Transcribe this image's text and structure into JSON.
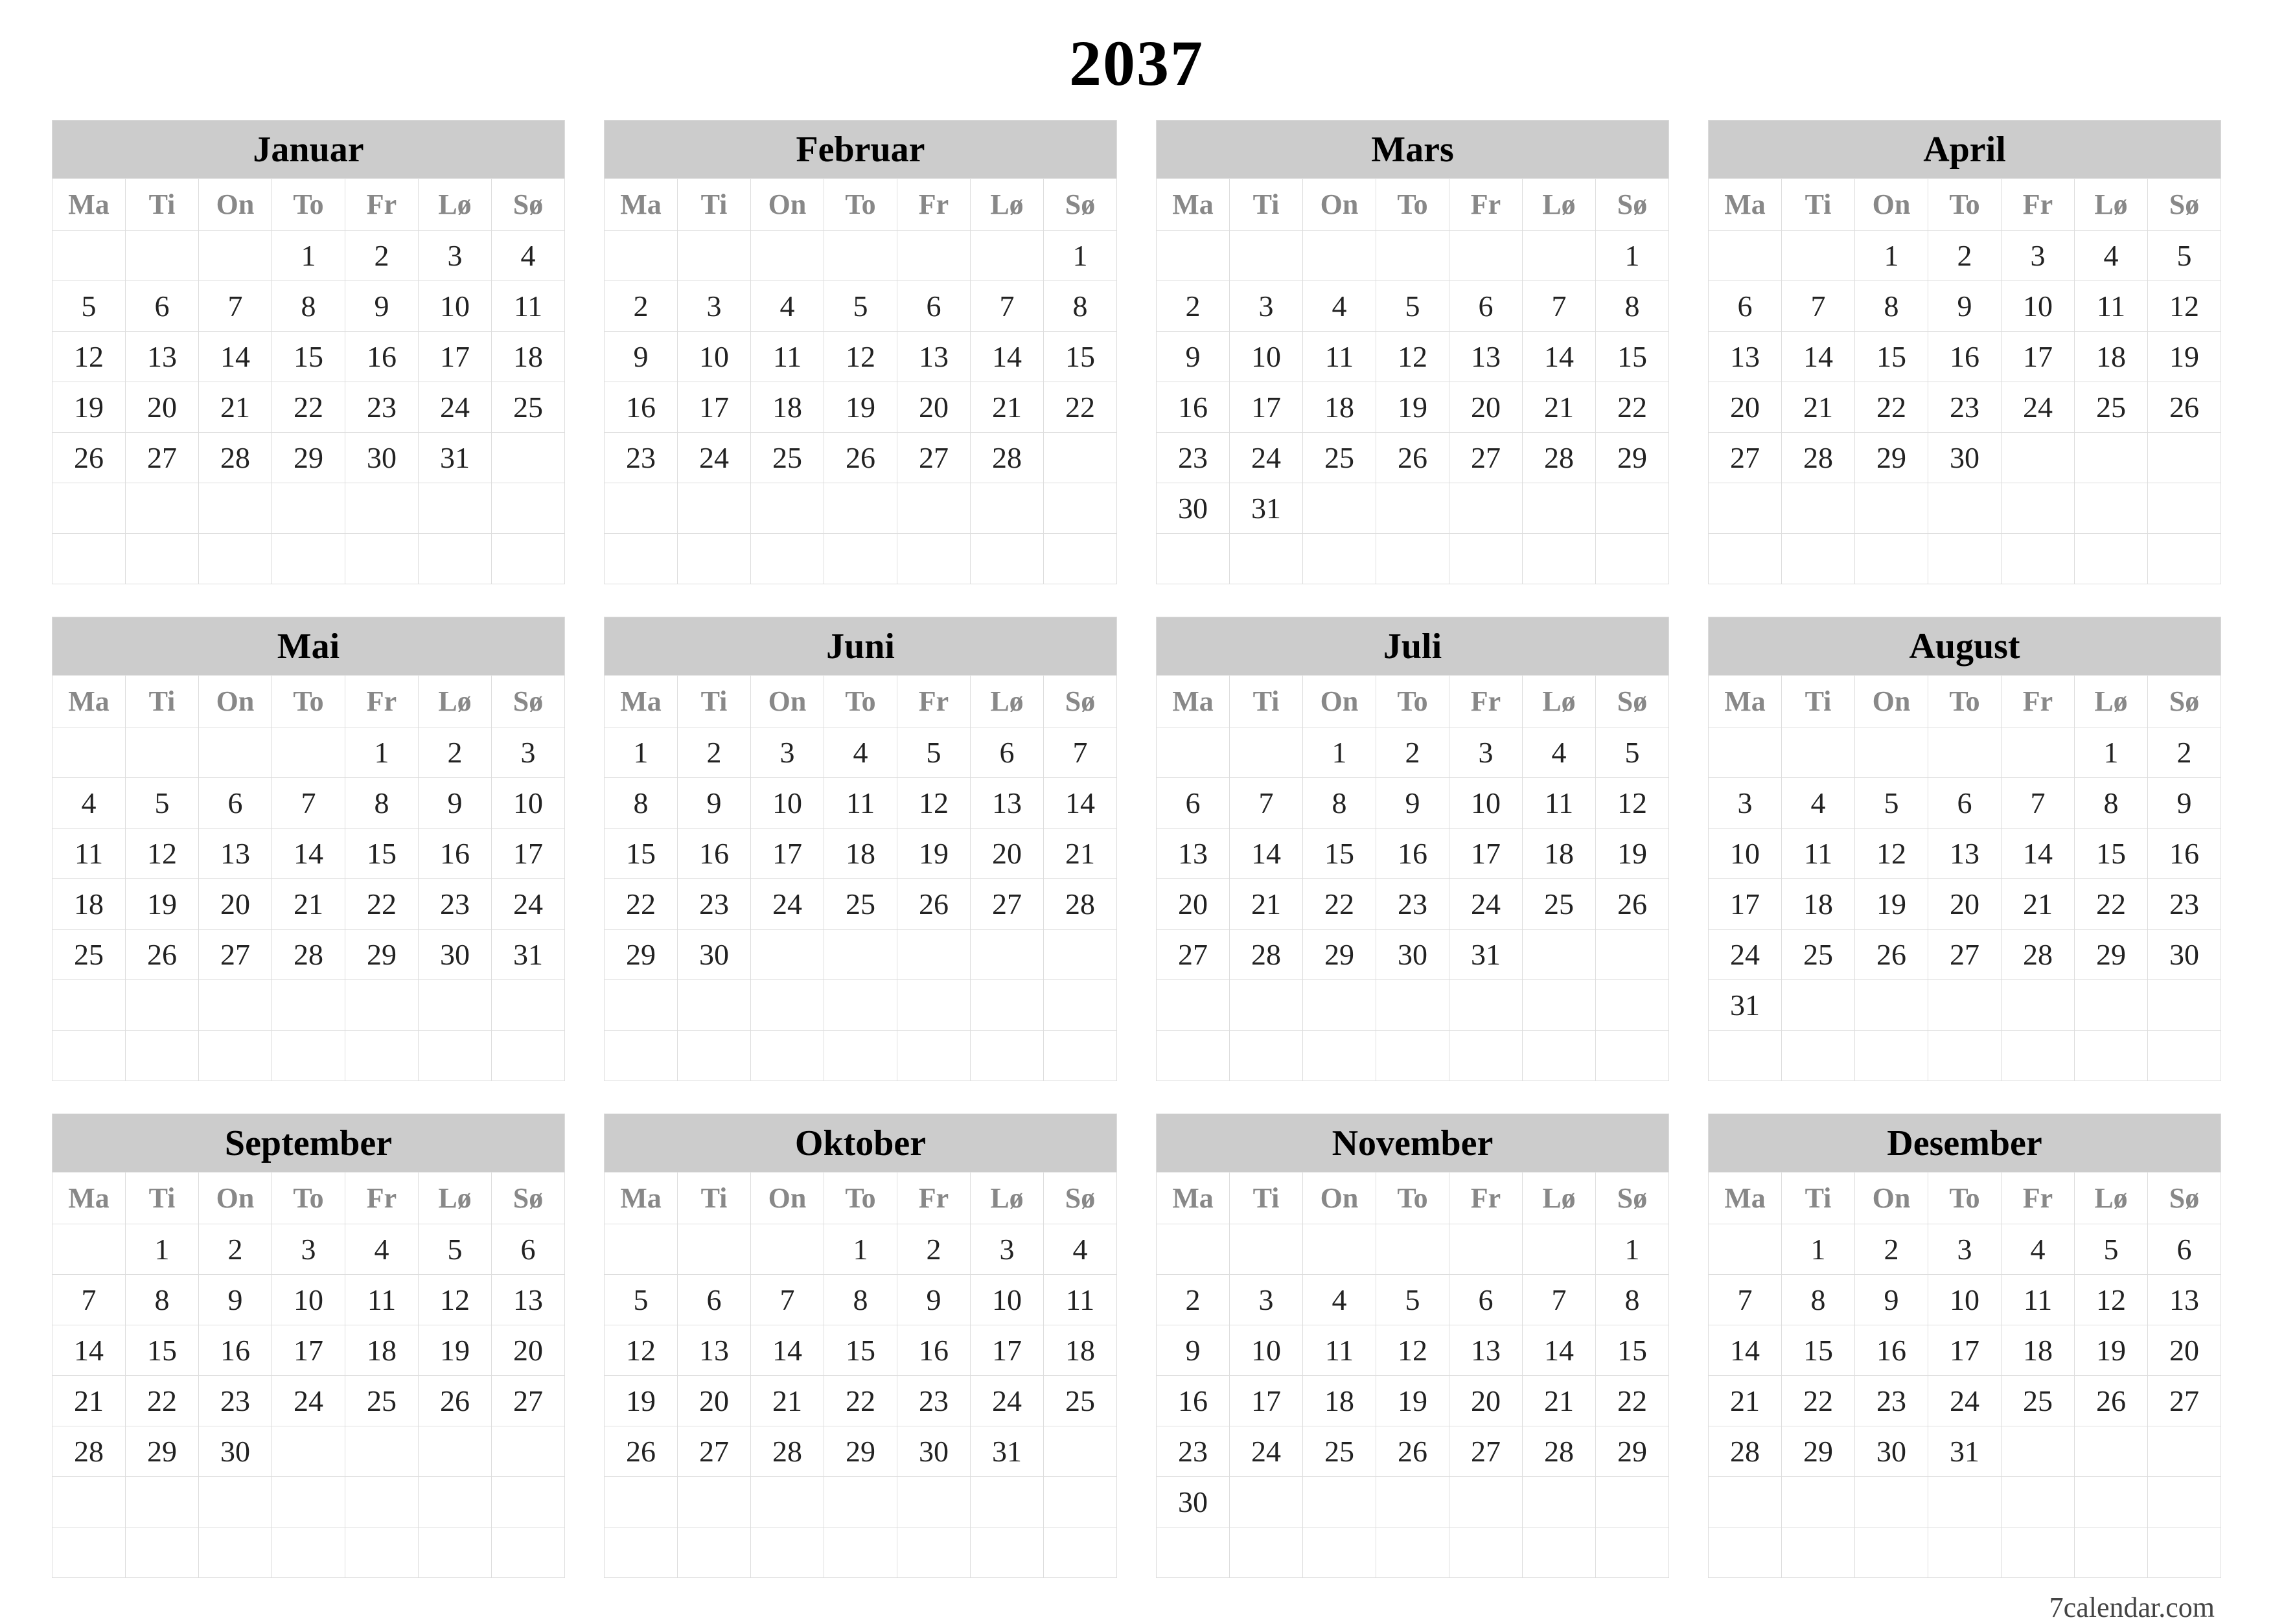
{
  "year": "2037",
  "footer": "7calendar.com",
  "weekdays": [
    "Ma",
    "Ti",
    "On",
    "To",
    "Fr",
    "Lø",
    "Sø"
  ],
  "months": [
    {
      "name": "Januar",
      "start": 4,
      "days": 31
    },
    {
      "name": "Februar",
      "start": 7,
      "days": 28
    },
    {
      "name": "Mars",
      "start": 7,
      "days": 31
    },
    {
      "name": "April",
      "start": 3,
      "days": 30
    },
    {
      "name": "Mai",
      "start": 5,
      "days": 31
    },
    {
      "name": "Juni",
      "start": 1,
      "days": 30
    },
    {
      "name": "Juli",
      "start": 3,
      "days": 31
    },
    {
      "name": "August",
      "start": 6,
      "days": 31
    },
    {
      "name": "September",
      "start": 2,
      "days": 30
    },
    {
      "name": "Oktober",
      "start": 4,
      "days": 31
    },
    {
      "name": "November",
      "start": 7,
      "days": 30
    },
    {
      "name": "Desember",
      "start": 2,
      "days": 31
    }
  ]
}
